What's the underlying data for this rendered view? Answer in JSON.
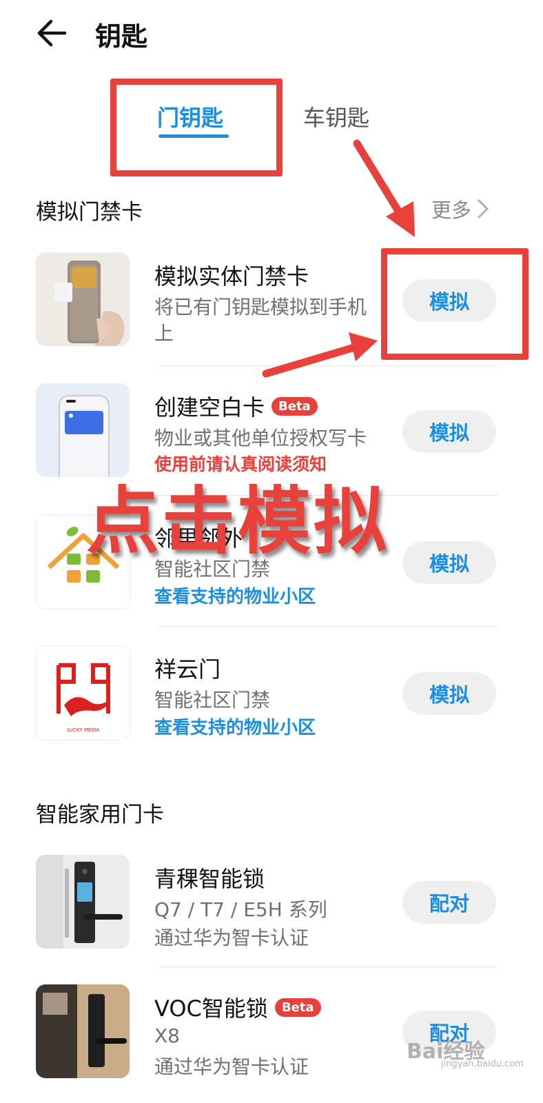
{
  "header": {
    "title": "钥匙"
  },
  "tabs": [
    {
      "label": "门钥匙"
    },
    {
      "label": "车钥匙"
    }
  ],
  "section1": {
    "title": "模拟门禁卡",
    "more_label": "更多"
  },
  "section2": {
    "title": "智能家用门卡"
  },
  "items": [
    {
      "title": "模拟实体门禁卡",
      "subtitle_line1": "将已有门钥匙模拟到手机",
      "subtitle_line2": "上",
      "button": "模拟"
    },
    {
      "title": "创建空白卡",
      "badge": "Beta",
      "subtitle": "物业或其他单位授权写卡",
      "notice": "使用前请认真阅读须知",
      "button": "模拟"
    },
    {
      "title": "邻里邻外",
      "subtitle": "智能社区门禁",
      "link": "查看支持的物业小区",
      "button": "模拟"
    },
    {
      "title": "祥云门",
      "subtitle": "智能社区门禁",
      "link": "查看支持的物业小区",
      "button": "模拟",
      "logo_caption": "LUCKY MEDIA"
    },
    {
      "title": "青稞智能锁",
      "subtitle": "Q7 / T7 / E5H 系列",
      "note": "通过华为智卡认证",
      "button": "配对"
    },
    {
      "title": "VOC智能锁",
      "badge": "Beta",
      "subtitle": "X8",
      "note": "通过华为智卡认证",
      "button": "配对"
    }
  ],
  "annotation": {
    "text": "点击模拟"
  },
  "watermark": {
    "brand": "Bai经验",
    "url": "jingyan.baidu.com"
  },
  "colors": {
    "accent": "#1a8ee0",
    "annotation": "#e8403a",
    "badge": "#e8403a",
    "button_bg": "#efefef"
  }
}
